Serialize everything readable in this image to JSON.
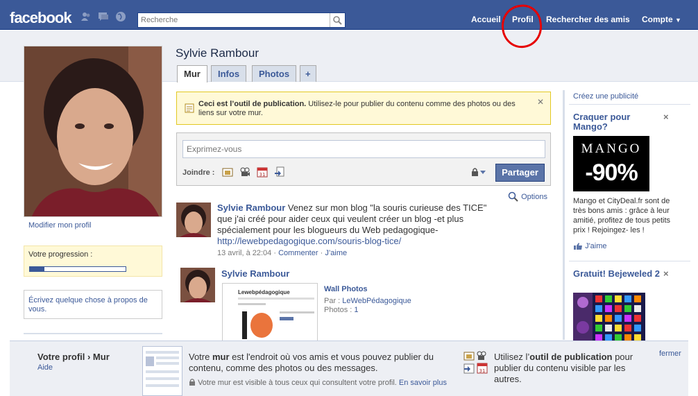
{
  "topbar": {
    "logo": "facebook",
    "search_placeholder": "Recherche",
    "nav": {
      "home": "Accueil",
      "profile": "Profil",
      "find_friends": "Rechercher des amis",
      "account": "Compte"
    }
  },
  "profile": {
    "name": "Sylvie Rambour",
    "tabs": [
      "Mur",
      "Infos",
      "Photos",
      "+"
    ],
    "edit_link": "Modifier mon profil",
    "progress_label": "Votre progression :",
    "progress_fraction": 0.15,
    "about_prompt": "Écrivez quelque chose à propos de vous."
  },
  "publisher": {
    "tip_bold": "Ceci est l’outil de publication.",
    "tip_text": " Utilisez-le pour publier du contenu comme des photos ou des liens sur votre mur.",
    "input_placeholder": "Exprimez-vous",
    "attach_label": "Joindre :",
    "share_label": "Partager"
  },
  "feed": {
    "options_label": "Options",
    "story1": {
      "actor": "Sylvie Rambour",
      "text": " Venez sur mon blog \"la souris curieuse des TICE\" que j'ai créé pour aider ceux qui veulent créer un blog -et plus spécialement pour les blogueurs du Web pedagogique-",
      "link": "http://lewebpedagogique.com/souris-blog-tice/",
      "time": "13 avril, à 22:04 · ",
      "comment": "Commenter",
      "sep": " · ",
      "like": "J’aime"
    },
    "story2": {
      "actor": "Sylvie Rambour",
      "album_title": "Wall Photos",
      "by_label": "Par : ",
      "by_name": "LeWebPédagogique",
      "photos_label": "Photos : ",
      "photos_count": "1",
      "thumb_brand": "Lewebpédagogique"
    }
  },
  "sidebar": {
    "create_ad": "Créez une publicité",
    "ad1": {
      "title": "Craquer pour Mango?",
      "img_brand": "MANGO",
      "img_discount": "-90%",
      "text": "Mango et CityDeal.fr sont de très bons amis : grâce à leur amitié, profitez de tous petits prix ! Rejoingez- les !",
      "like": "J'aime"
    },
    "ad2": {
      "title": "Gratuit! Bejeweled 2"
    },
    "close": "×"
  },
  "bottombar": {
    "title": "Votre profil › Mur",
    "help": "Aide",
    "text_pre": "Votre ",
    "text_bold": "mur",
    "text_post": " est l'endroit où vos amis et vous pouvez publier du contenu, comme des photos ou des messages.",
    "note_pre": "Votre mur est visible à tous ceux qui consultent votre profil. ",
    "note_link": "En savoir plus",
    "tool_pre": "Utilisez l’",
    "tool_bold": "outil de publication",
    "tool_post": " pour publier du contenu visible par les autres.",
    "close": "fermer"
  },
  "colors": {
    "brand": "#3b5998",
    "annotation": "#e60000",
    "tip_bg": "#fff9d7"
  }
}
